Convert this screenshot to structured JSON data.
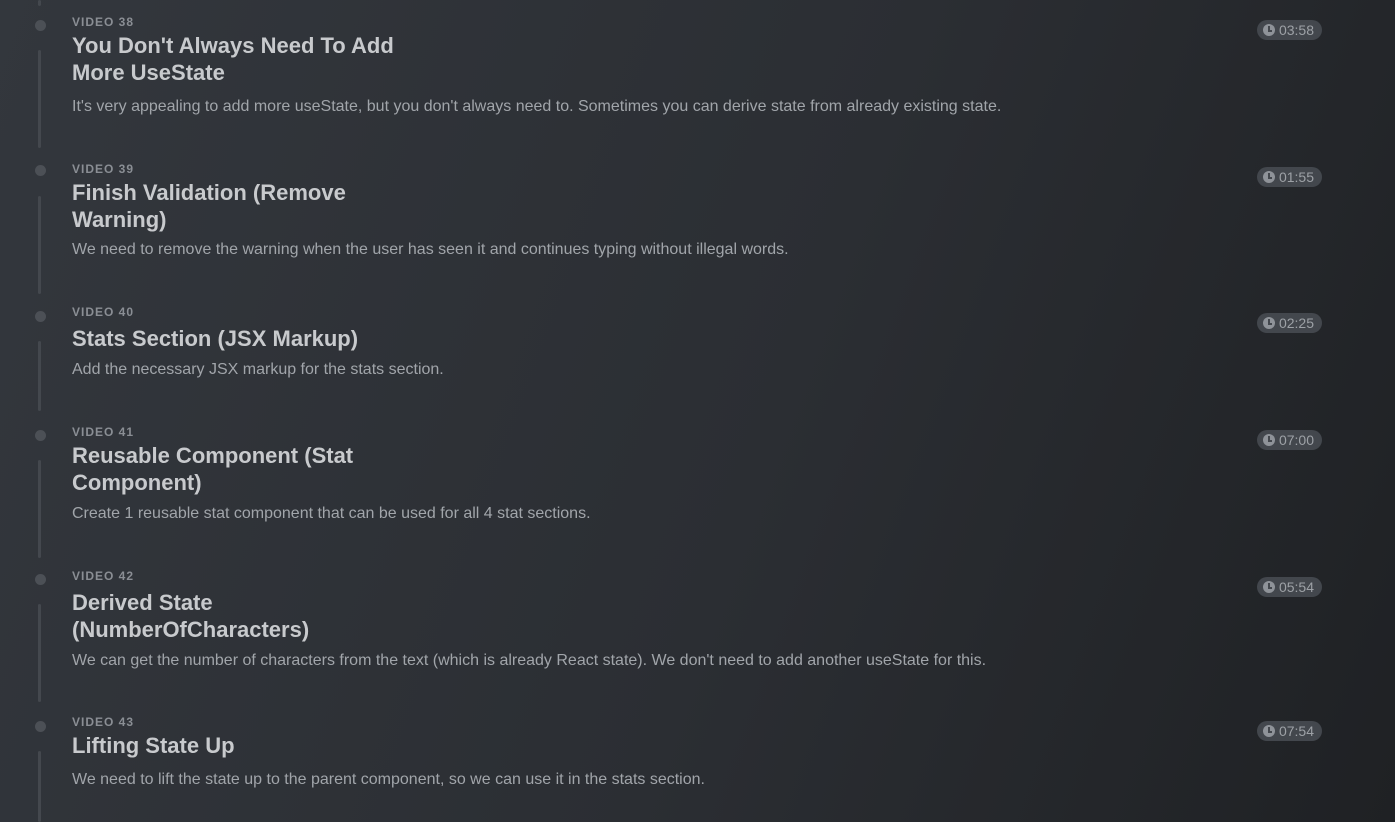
{
  "videos": [
    {
      "label": "VIDEO 38",
      "title": "You Don't Always Need To Add More UseState",
      "description": "It's very appealing to add more useState, but you don't always need to. Sometimes you can derive state from already existing state.",
      "duration": "03:58"
    },
    {
      "label": "VIDEO 39",
      "title": "Finish Validation (Remove Warning)",
      "description": "We need to remove the warning when the user has seen it and continues typing without illegal words.",
      "duration": "01:55"
    },
    {
      "label": "VIDEO 40",
      "title": "Stats Section (JSX Markup)",
      "description": "Add the necessary JSX markup for the stats section.",
      "duration": "02:25"
    },
    {
      "label": "VIDEO 41",
      "title": "Reusable Component (Stat Component)",
      "description": "Create 1 reusable stat component that can be used for all 4 stat sections.",
      "duration": "07:00"
    },
    {
      "label": "VIDEO 42",
      "title": "Derived State (NumberOfCharacters)",
      "description": "We can get the number of characters from the text (which is already React state). We don't need to add another useState for this.",
      "duration": "05:54"
    },
    {
      "label": "VIDEO 43",
      "title": "Lifting State Up",
      "description": "We need to lift the state up to the parent component, so we can use it in the stats section.",
      "duration": "07:54"
    }
  ],
  "icons": {
    "dot": "timeline-dot-icon",
    "clock": "clock-icon"
  }
}
